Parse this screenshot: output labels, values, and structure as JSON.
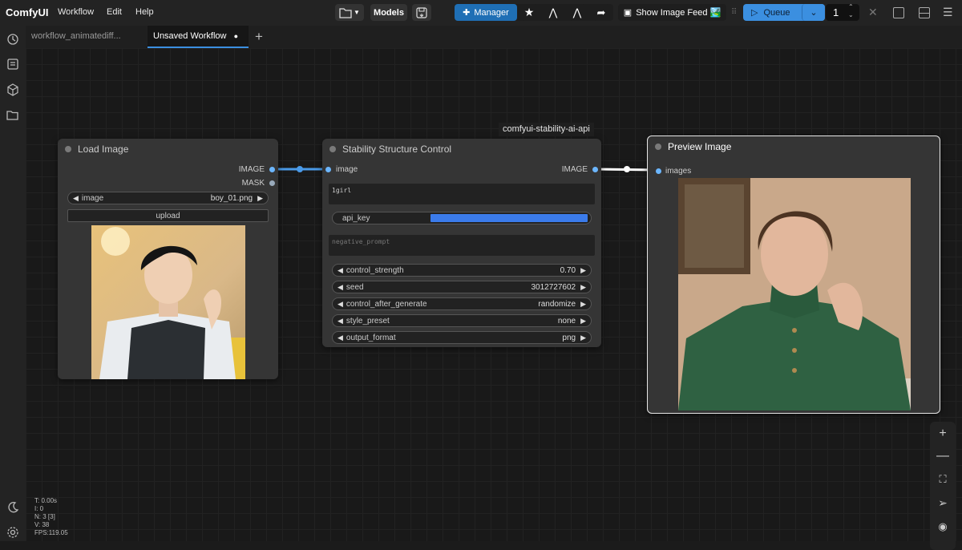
{
  "topbar": {
    "brand": "ComfyUI",
    "menu": [
      "Workflow",
      "Edit",
      "Help"
    ],
    "models_label": "Models",
    "manager_label": "Manager",
    "image_feed_label": "Show Image Feed 🏞️",
    "queue_label": "Queue",
    "queue_count": "1"
  },
  "tabs": [
    {
      "label": "workflow_animatediff...",
      "active": false
    },
    {
      "label": "Unsaved Workflow",
      "active": true,
      "modified_dot": "●"
    }
  ],
  "new_tab_label": "+",
  "nodes": {
    "load_image": {
      "title": "Load Image",
      "outputs": [
        "IMAGE",
        "MASK"
      ],
      "image_widget": {
        "label": "image",
        "value": "boy_01.png"
      },
      "upload_label": "upload"
    },
    "stability": {
      "group_badge": "comfyui-stability-ai-api",
      "title": "Stability Structure Control",
      "input": "image",
      "output": "IMAGE",
      "prompt_text": "1girl",
      "api_key_label": "api_key",
      "negative_prompt_placeholder": "negative_prompt",
      "widgets": [
        {
          "label": "control_strength",
          "value": "0.70"
        },
        {
          "label": "seed",
          "value": "3012727602"
        },
        {
          "label": "control_after_generate",
          "value": "randomize"
        },
        {
          "label": "style_preset",
          "value": "none"
        },
        {
          "label": "output_format",
          "value": "png"
        }
      ]
    },
    "preview": {
      "title": "Preview Image",
      "input": "images"
    }
  },
  "stats": [
    "T: 0.00s",
    "I: 0",
    "N: 3 [3]",
    "V: 38",
    "FPS:119.05"
  ],
  "colors": {
    "link_blue": "#4a9ae8",
    "link_white": "#ffffff",
    "accent": "#3b8fe0",
    "manager_bg": "#1f6fb5"
  }
}
